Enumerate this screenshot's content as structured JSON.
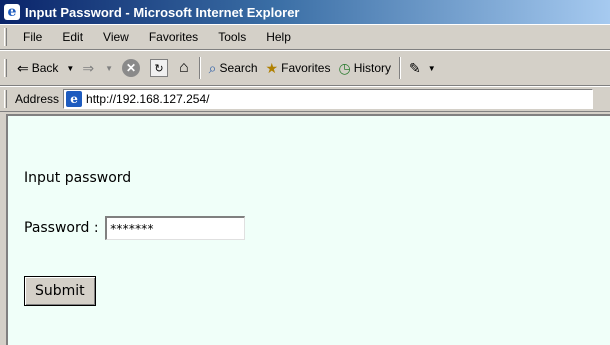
{
  "window": {
    "title": "Input Password - Microsoft Internet Explorer",
    "icon": "ie-logo-icon"
  },
  "menu": {
    "items": [
      "File",
      "Edit",
      "View",
      "Favorites",
      "Tools",
      "Help"
    ]
  },
  "toolbar": {
    "back_label": "Back",
    "search_label": "Search",
    "favorites_label": "Favorites",
    "history_label": "History"
  },
  "address": {
    "label": "Address",
    "url": "http://192.168.127.254/"
  },
  "page": {
    "background": "#f0fff9",
    "heading": "Input password",
    "password_label": "Password :",
    "password_value": "*******",
    "submit_label": "Submit"
  }
}
